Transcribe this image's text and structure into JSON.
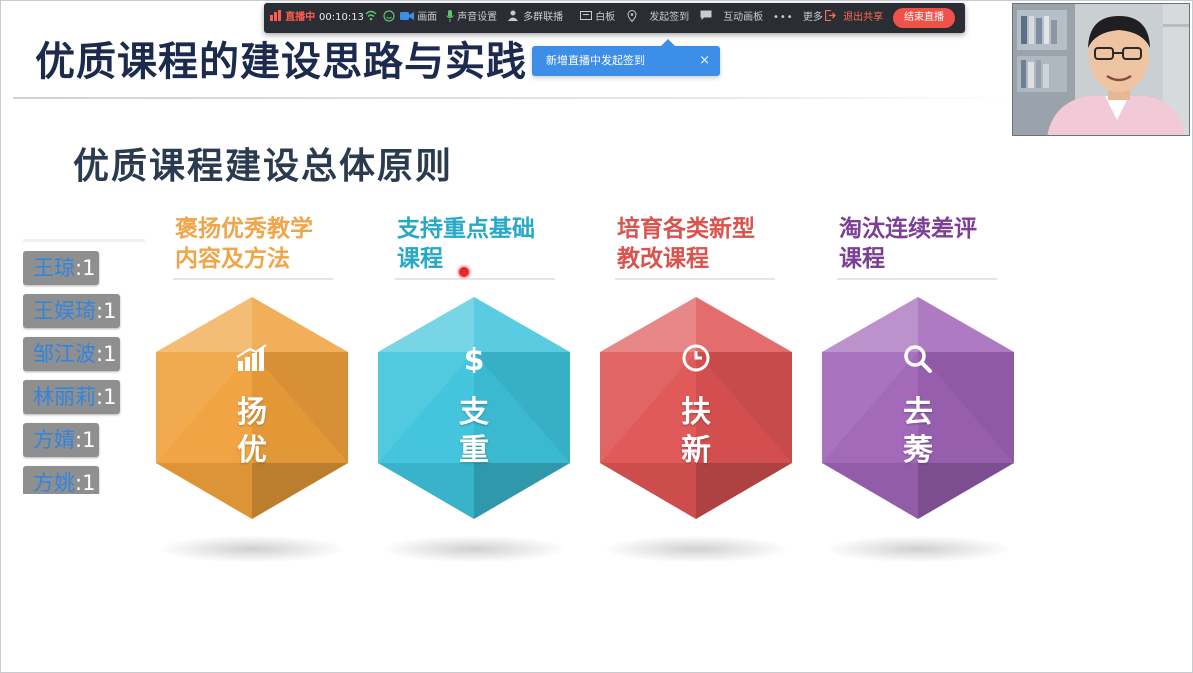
{
  "slide": {
    "title": "优质课程的建设思路与实践",
    "subtitle": "优质课程建设总体原则",
    "columns": [
      {
        "header": "褒扬优秀教学内容及方法",
        "header_lines": [
          "褒扬优秀教学",
          "内容及方法"
        ],
        "chars": [
          "扬",
          "优"
        ],
        "icon": "bar-chart-icon",
        "color": "#f0a13c",
        "header_color": "#efa54a"
      },
      {
        "header": "支持重点基础课程",
        "header_lines": [
          "支持重点基础",
          "课程"
        ],
        "chars": [
          "支",
          "重"
        ],
        "icon": "dollar-icon",
        "color": "#3ec3dc",
        "header_color": "#27a9c6"
      },
      {
        "header": "培育各类新型教改课程",
        "header_lines": [
          "培育各类新型",
          "教改课程"
        ],
        "chars": [
          "扶",
          "新"
        ],
        "icon": "clock-icon",
        "color": "#df5454",
        "header_color": "#d9534f"
      },
      {
        "header": "淘汰连续差评课程",
        "header_lines": [
          "淘汰连续差评",
          "课程"
        ],
        "chars": [
          "去",
          "莠"
        ],
        "icon": "search-icon",
        "color": "#a064b8",
        "header_color": "#7d3f96"
      }
    ]
  },
  "signin_list": [
    {
      "name": "王琼",
      "score": ":1"
    },
    {
      "name": "王娱琦",
      "score": ":1"
    },
    {
      "name": "邹江波",
      "score": ":1"
    },
    {
      "name": "林丽莉",
      "score": ":1"
    },
    {
      "name": "方婧",
      "score": ":1"
    },
    {
      "name": "方姚",
      "score": ":1"
    }
  ],
  "toolbar": {
    "live_label": "直播中",
    "timer": "00:10:13",
    "items": [
      "画面",
      "声音设置",
      "多群联播",
      "白板",
      "发起签到",
      "互动画板",
      "更多"
    ],
    "exit_label": "退出共享",
    "end_label": "结束直播"
  },
  "tooltip": {
    "text": "新增直播中发起签到",
    "close": "×"
  },
  "colors": {
    "title": "#1c2a4d",
    "toolbar_bg": "#2a2d33",
    "tooltip_bg": "#3d8ee6",
    "end_button": "#f0524a"
  }
}
